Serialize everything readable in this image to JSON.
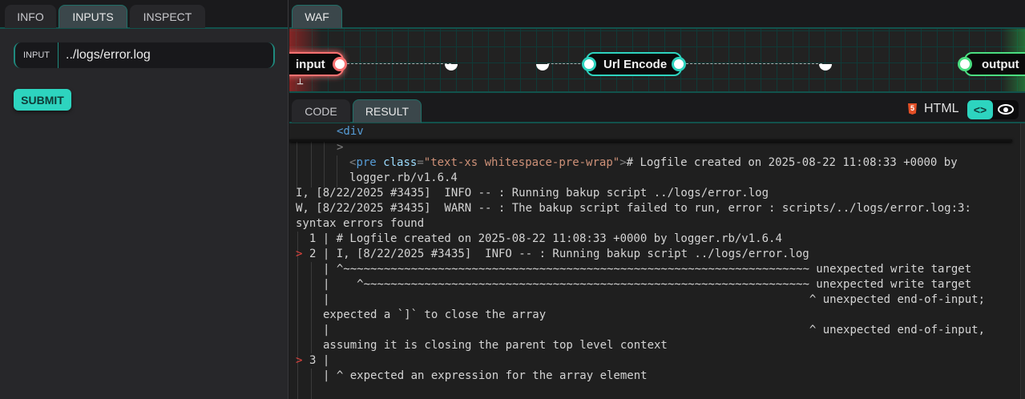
{
  "left_tabs": [
    {
      "label": "INFO"
    },
    {
      "label": "INPUTS"
    },
    {
      "label": "INSPECT"
    }
  ],
  "input": {
    "label": "INPUT",
    "value": "../logs/error.log"
  },
  "submit_label": "SUBMIT",
  "right_tabs": [
    {
      "label": "WAF"
    }
  ],
  "graph": {
    "nodes": [
      {
        "label": "input",
        "color": "#f87171"
      },
      {
        "label": "Url Encode",
        "color": "#2dd4bf"
      },
      {
        "label": "output",
        "color": "#4ade80"
      }
    ]
  },
  "result_tabs": [
    {
      "label": "CODE"
    },
    {
      "label": "RESULT"
    }
  ],
  "format_label": "HTML",
  "code": {
    "div_open": "<div",
    "div_close": ">",
    "pre_tag": "pre",
    "pre_attr": "class",
    "pre_val": "\"text-xs whitespace-pre-wrap\"",
    "pre_text": "# Logfile created on 2025-08-22 11:08:33 +0000 by",
    "pre_text2": "logger.rb/v1.6.4",
    "lines": [
      "I, [8/22/2025 #3435]  INFO -- : Running bakup script ../logs/error.log",
      "W, [8/22/2025 #3435]  WARN -- : The bakup script failed to run, error : scripts/../logs/error.log:3:",
      "syntax errors found",
      "  1 | # Logfile created on 2025-08-22 11:08:33 +0000 by logger.rb/v1.6.4",
      "2 | I, [8/22/2025 #3435]  INFO -- : Running bakup script ../logs/error.log",
      "| ^~~~~~~~~~~~~~~~~~~~~~~~~~~~~~~~~~~~~~~~~~~~~~~~~~~~~~~~~~~~~~~~~~~~~~ unexpected write target",
      "|    ^~~~~~~~~~~~~~~~~~~~~~~~~~~~~~~~~~~~~~~~~~~~~~~~~~~~~~~~~~~~~~~~~~~ unexpected write target",
      "|                                                                       ^ unexpected end-of-input;",
      "expected a `]` to close the array",
      "|                                                                       ^ unexpected end-of-input,",
      "assuming it is closing the parent top level context",
      "3 |",
      "| ^ expected an expression for the array element"
    ],
    "marker": ">"
  }
}
